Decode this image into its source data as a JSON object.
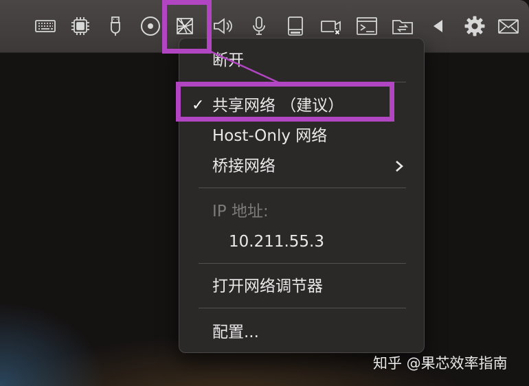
{
  "toolbar": {
    "icons": [
      "keyboard-icon",
      "cpu-chip-icon",
      "usb-icon",
      "disc-icon",
      "network-icon",
      "speaker-icon",
      "microphone-icon",
      "hard-drive-icon",
      "camera-off-icon",
      "terminal-icon",
      "shared-folder-icon",
      "back-triangle-icon",
      "gear-icon",
      "mail-icon"
    ]
  },
  "menu": {
    "disconnect": "断开",
    "shared_network": "共享网络 （建议）",
    "shared_network_checked": true,
    "check_mark": "✓",
    "host_only": "Host-Only 网络",
    "bridged": "桥接网络",
    "ip_label": "IP 地址:",
    "ip_value": "10.211.55.3",
    "open_prefs": "打开网络调节器",
    "configure": "配置..."
  },
  "highlight_color": "#b246c2",
  "watermark": "知乎 @果芯效率指南"
}
